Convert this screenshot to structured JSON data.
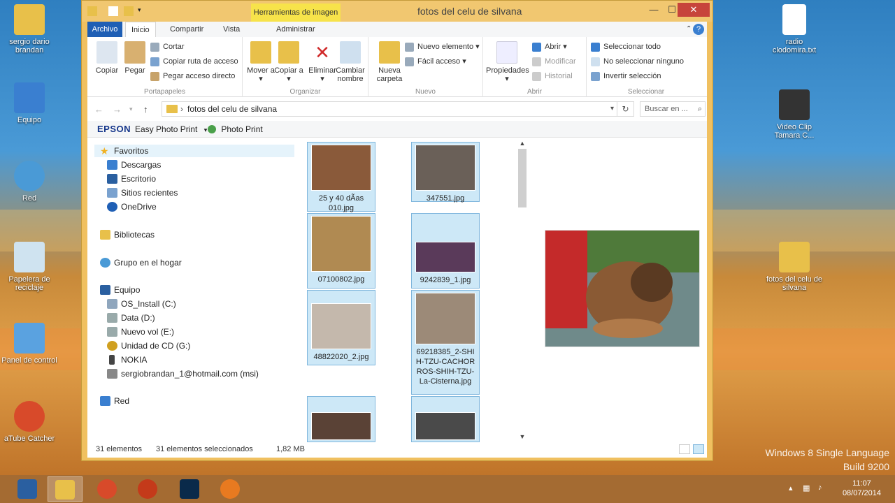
{
  "window": {
    "title": "fotos del celu de silvana",
    "context_tab_label": "Herramientas de imagen",
    "minimize": "—",
    "maximize": "☐",
    "close": "✕"
  },
  "ribbon_tabs": {
    "file": "Archivo",
    "home": "Inicio",
    "share": "Compartir",
    "view": "Vista",
    "manage": "Administrar"
  },
  "ribbon": {
    "clipboard": {
      "label": "Portapapeles",
      "copy": "Copiar",
      "paste": "Pegar",
      "cut": "Cortar",
      "copy_path": "Copiar ruta de acceso",
      "paste_shortcut": "Pegar acceso directo"
    },
    "organize": {
      "label": "Organizar",
      "move_to": "Mover a ▾",
      "copy_to": "Copiar a ▾",
      "delete": "Eliminar ▾",
      "rename": "Cambiar nombre"
    },
    "new": {
      "label": "Nuevo",
      "new_folder": "Nueva carpeta",
      "new_item": "Nuevo elemento ▾",
      "easy_access": "Fácil acceso ▾"
    },
    "open": {
      "label": "Abrir",
      "properties": "Propiedades ▾",
      "open": "Abrir ▾",
      "edit": "Modificar",
      "history": "Historial"
    },
    "select": {
      "label": "Seleccionar",
      "select_all": "Seleccionar todo",
      "select_none": "No seleccionar ninguno",
      "invert": "Invertir selección"
    }
  },
  "addressbar": {
    "path": "fotos del celu de silvana",
    "search_placeholder": "Buscar en ..."
  },
  "epson": {
    "logo": "EPSON",
    "easy_photo_print": "Easy Photo Print",
    "photo_print": "Photo Print"
  },
  "nav": {
    "favorites": "Favoritos",
    "downloads": "Descargas",
    "desktop": "Escritorio",
    "recent": "Sitios recientes",
    "onedrive": "OneDrive",
    "libraries": "Bibliotecas",
    "homegroup": "Grupo en el hogar",
    "computer": "Equipo",
    "os_install": "OS_Install (C:)",
    "data": "Data (D:)",
    "new_volume": "Nuevo vol (E:)",
    "cd_drive": "Unidad de CD (G:)",
    "nokia": "NOKIA",
    "msi_account": "sergiobrandan_1@hotmail.com (msi)",
    "network": "Red"
  },
  "files": [
    {
      "name": "25 y 40 dÃ­as 010.jpg",
      "color": "#8a5a3a"
    },
    {
      "name": "347551.jpg",
      "color": "#6a6058"
    },
    {
      "name": "07100802.jpg",
      "color": "#b08a52"
    },
    {
      "name": "9242839_1.jpg",
      "color": "#5a3a5a"
    },
    {
      "name": "48822020_2.jpg",
      "color": "#c4b8ac"
    },
    {
      "name": "69218385_2-SHIH-TZU-CACHORROS-SHIH-TZU-La-Cisterna.jpg",
      "color": "#9c8a78"
    },
    {
      "name": "",
      "color": "#5a4236"
    },
    {
      "name": "",
      "color": "#4a4a4a"
    }
  ],
  "status": {
    "count": "31 elementos",
    "selected": "31 elementos seleccionados",
    "size": "1,82 MB"
  },
  "desktop": {
    "icons_left": [
      {
        "label": "sergio dario brandan"
      },
      {
        "label": "Equipo"
      },
      {
        "label": "Red"
      },
      {
        "label": "Papelera de reciclaje"
      },
      {
        "label": "Panel de control"
      },
      {
        "label": "aTube Catcher"
      }
    ],
    "icons_right": [
      {
        "label": "radio clodomira.txt"
      },
      {
        "label": "Video Clip Tamara C..."
      },
      {
        "label": "fotos del celu de silvana"
      }
    ],
    "watermark_line1": "Windows 8 Single Language",
    "watermark_line2": "Build 9200"
  },
  "taskbar": {
    "time": "11:07",
    "date": "08/07/2014"
  },
  "colors": {
    "accent": "#1f5fb5",
    "titlebar": "#f1c770",
    "selection": "#cde8f7",
    "taskbar": "#a46b32"
  }
}
